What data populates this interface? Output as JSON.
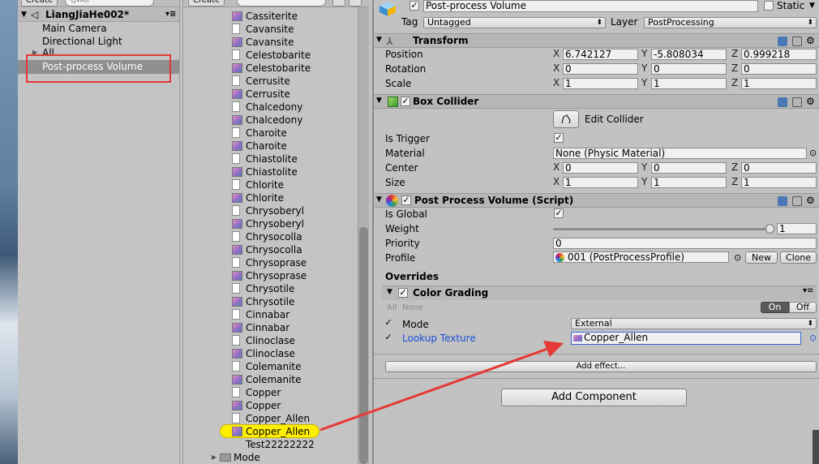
{
  "hierarchy": {
    "create_label": "Create",
    "search_placeholder": "Q▾All",
    "scene_name": "LiangJiaHe002*",
    "items": [
      "Main Camera",
      "Directional Light",
      "All",
      "Post-process Volume"
    ]
  },
  "project": {
    "create_label": "Create",
    "items": [
      {
        "label": "Cassiterite",
        "icon": "texture-icon"
      },
      {
        "label": "Cavansite",
        "icon": "file-icon"
      },
      {
        "label": "Cavansite",
        "icon": "texture-icon"
      },
      {
        "label": "Celestobarite",
        "icon": "file-icon"
      },
      {
        "label": "Celestobarite",
        "icon": "texture-icon"
      },
      {
        "label": "Cerrusite",
        "icon": "file-icon"
      },
      {
        "label": "Cerrusite",
        "icon": "texture-icon"
      },
      {
        "label": "Chalcedony",
        "icon": "file-icon"
      },
      {
        "label": "Chalcedony",
        "icon": "texture-icon"
      },
      {
        "label": "Charoite",
        "icon": "file-icon"
      },
      {
        "label": "Charoite",
        "icon": "texture-icon"
      },
      {
        "label": "Chiastolite",
        "icon": "file-icon"
      },
      {
        "label": "Chiastolite",
        "icon": "texture-icon"
      },
      {
        "label": "Chlorite",
        "icon": "file-icon"
      },
      {
        "label": "Chlorite",
        "icon": "texture-icon"
      },
      {
        "label": "Chrysoberyl",
        "icon": "file-icon"
      },
      {
        "label": "Chrysoberyl",
        "icon": "texture-icon"
      },
      {
        "label": "Chrysocolla",
        "icon": "file-icon"
      },
      {
        "label": "Chrysocolla",
        "icon": "texture-icon"
      },
      {
        "label": "Chrysoprase",
        "icon": "file-icon"
      },
      {
        "label": "Chrysoprase",
        "icon": "texture-icon"
      },
      {
        "label": "Chrysotile",
        "icon": "file-icon"
      },
      {
        "label": "Chrysotile",
        "icon": "texture-icon"
      },
      {
        "label": "Cinnabar",
        "icon": "file-icon"
      },
      {
        "label": "Cinnabar",
        "icon": "texture-icon"
      },
      {
        "label": "Clinoclase",
        "icon": "file-icon"
      },
      {
        "label": "Clinoclase",
        "icon": "texture-icon"
      },
      {
        "label": "Colemanite",
        "icon": "file-icon"
      },
      {
        "label": "Colemanite",
        "icon": "texture-icon"
      },
      {
        "label": "Copper",
        "icon": "file-icon"
      },
      {
        "label": "Copper",
        "icon": "texture-icon"
      },
      {
        "label": "Copper_Allen",
        "icon": "file-icon"
      },
      {
        "label": "Copper_Allen",
        "icon": "texture-icon"
      },
      {
        "label": "Test22222222",
        "icon": "none"
      },
      {
        "label": "Mode",
        "icon": "folder-icon"
      }
    ]
  },
  "inspector": {
    "object_name": "Post-process Volume",
    "static_label": "Static",
    "tag_label": "Tag",
    "tag_value": "Untagged",
    "layer_label": "Layer",
    "layer_value": "PostProcessing",
    "transform": {
      "title": "Transform",
      "position_label": "Position",
      "rotation_label": "Rotation",
      "scale_label": "Scale",
      "position": [
        "6.742127",
        "-5.808034",
        "0.999218"
      ],
      "rotation": [
        "0",
        "0",
        "0"
      ],
      "scale": [
        "1",
        "1",
        "1"
      ]
    },
    "box_collider": {
      "title": "Box Collider",
      "edit_collider_label": "Edit Collider",
      "is_trigger_label": "Is Trigger",
      "material_label": "Material",
      "material_value": "None (Physic Material)",
      "center_label": "Center",
      "size_label": "Size",
      "center": [
        "0",
        "0",
        "0"
      ],
      "size": [
        "1",
        "1",
        "1"
      ]
    },
    "ppv": {
      "title": "Post Process Volume (Script)",
      "is_global_label": "Is Global",
      "weight_label": "Weight",
      "weight_value": "1",
      "weight_fraction": 1.0,
      "priority_label": "Priority",
      "priority_value": "0",
      "profile_label": "Profile",
      "profile_value": "001 (PostProcessProfile)",
      "new_label": "New",
      "clone_label": "Clone",
      "overrides_label": "Overrides",
      "color_grading_label": "Color Grading",
      "all_label": "All",
      "none_label": "None",
      "on_label": "On",
      "off_label": "Off",
      "mode_label": "Mode",
      "mode_value": "External",
      "lookup_label": "Lookup Texture",
      "lookup_value": "Copper_Allen",
      "add_effect_label": "Add effect..."
    },
    "axis_labels": [
      "X",
      "Y",
      "Z"
    ],
    "add_component_label": "Add Component"
  },
  "colors": {
    "selection_red": "#e53935",
    "highlight_yellow": "#ffef00",
    "link_blue": "#1a4fd6",
    "arrow_red": "#e53935"
  }
}
